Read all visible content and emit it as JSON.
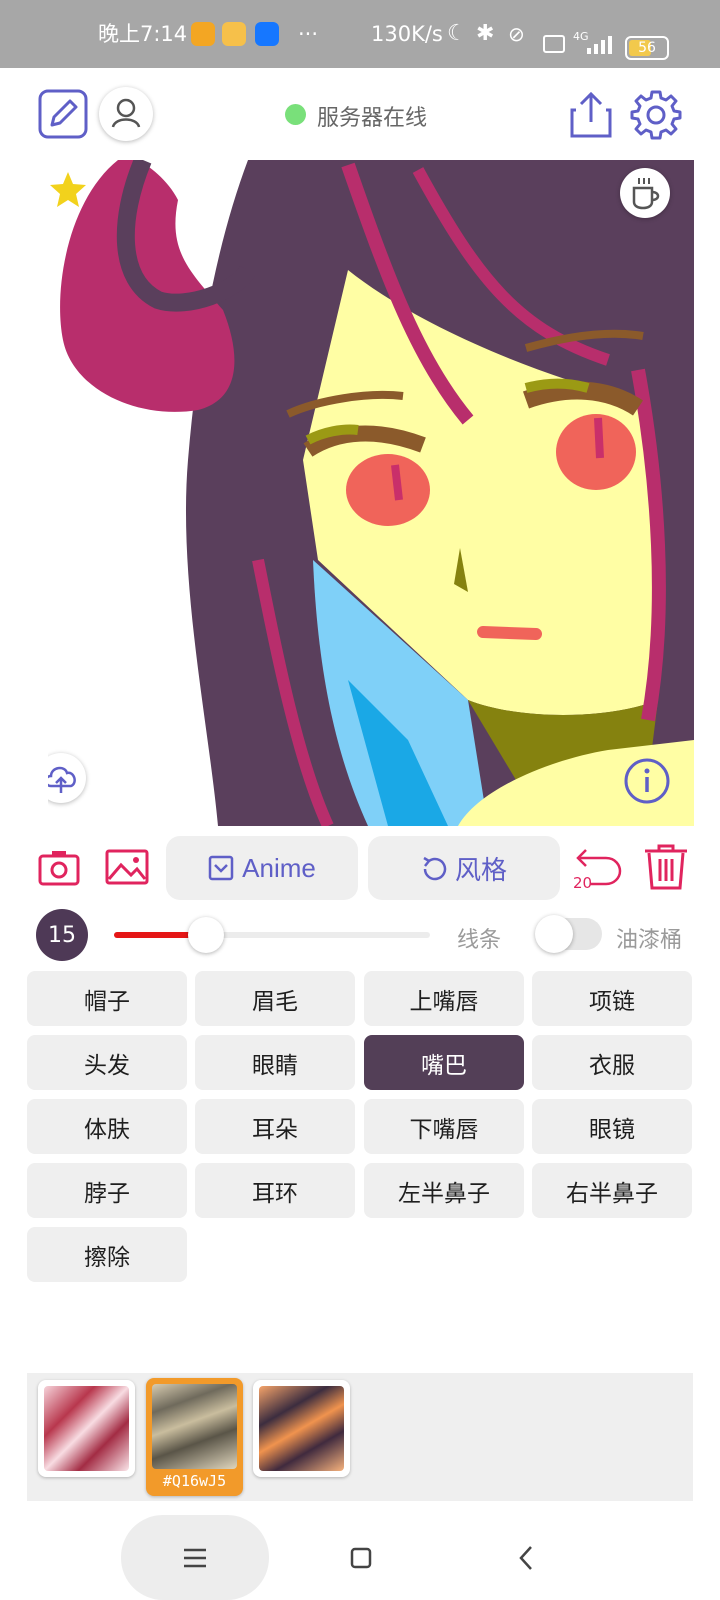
{
  "status_bar": {
    "time": "晚上7:14",
    "network_speed": "130K/s",
    "signal": "4G",
    "battery": "56",
    "overflow": "···"
  },
  "header": {
    "server_status": "服务器在线",
    "server_status_color": "#79e07a",
    "accent_color": "#5f5fc7"
  },
  "toolbar": {
    "anime_label": "Anime",
    "style_label": "风格",
    "undo_count": "20",
    "danger_color": "#e0245e"
  },
  "brush": {
    "size": "15",
    "slider_fraction": 0.29,
    "line_label": "线条",
    "bucket_label": "油漆桶",
    "bucket_enabled": false
  },
  "parts": [
    {
      "label": "帽子",
      "selected": false
    },
    {
      "label": "眉毛",
      "selected": false
    },
    {
      "label": "上嘴唇",
      "selected": false
    },
    {
      "label": "项链",
      "selected": false
    },
    {
      "label": "头发",
      "selected": false
    },
    {
      "label": "眼睛",
      "selected": false
    },
    {
      "label": "嘴巴",
      "selected": true
    },
    {
      "label": "衣服",
      "selected": false
    },
    {
      "label": "体肤",
      "selected": false
    },
    {
      "label": "耳朵",
      "selected": false
    },
    {
      "label": "下嘴唇",
      "selected": false
    },
    {
      "label": "眼镜",
      "selected": false
    },
    {
      "label": "脖子",
      "selected": false
    },
    {
      "label": "耳环",
      "selected": false
    },
    {
      "label": "左半鼻子",
      "selected": false
    },
    {
      "label": "右半鼻子",
      "selected": false
    },
    {
      "label": "擦除",
      "selected": false
    }
  ],
  "gallery": {
    "selected_code": "#Q16wJ5",
    "selected_index": 1
  }
}
